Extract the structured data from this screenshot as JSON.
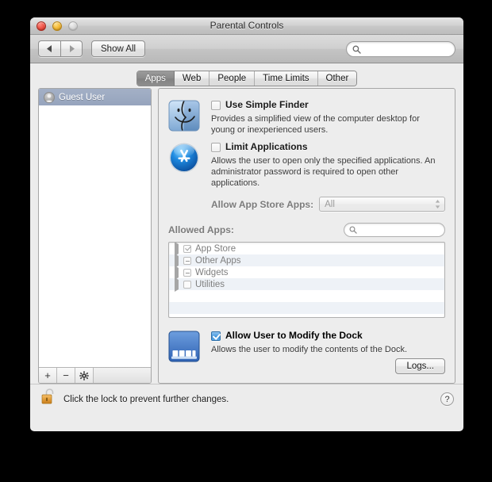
{
  "window": {
    "title": "Parental Controls",
    "traffic_lights": [
      "close",
      "minimize",
      "zoom-disabled"
    ]
  },
  "toolbar": {
    "back_icon": "triangle-left-icon",
    "forward_icon": "triangle-right-icon",
    "show_all_label": "Show All",
    "search": {
      "value": "",
      "placeholder": "",
      "icon": "search-icon"
    }
  },
  "tabs": [
    {
      "label": "Apps",
      "active": true
    },
    {
      "label": "Web",
      "active": false
    },
    {
      "label": "People",
      "active": false
    },
    {
      "label": "Time Limits",
      "active": false
    },
    {
      "label": "Other",
      "active": false
    }
  ],
  "sidebar": {
    "users": [
      {
        "name": "Guest User",
        "selected": true,
        "icon": "user-avatar-icon"
      }
    ],
    "footer": {
      "add_label": "+",
      "remove_label": "−",
      "gear_label": "⚙"
    }
  },
  "main": {
    "simple_finder": {
      "icon": "finder-icon",
      "checkbox_label": "Use Simple Finder",
      "checked": false,
      "description": "Provides a simplified view of the computer desktop for young or inexperienced users."
    },
    "limit_applications": {
      "icon": "app-store-icon",
      "checkbox_label": "Limit Applications",
      "checked": false,
      "description": "Allows the user to open only the specified applications. An administrator password is required to open other applications."
    },
    "allow_app_store": {
      "label": "Allow App Store Apps:",
      "value": "All",
      "disabled": true,
      "options": [
        "All"
      ]
    },
    "allowed_apps": {
      "label": "Allowed Apps:",
      "search": {
        "value": "",
        "placeholder": "",
        "icon": "search-icon"
      },
      "rows": [
        {
          "label": "App Store",
          "state": "checked",
          "expanded": false
        },
        {
          "label": "Other Apps",
          "state": "mixed",
          "expanded": false
        },
        {
          "label": "Widgets",
          "state": "mixed",
          "expanded": false
        },
        {
          "label": "Utilities",
          "state": "unchecked",
          "expanded": false
        }
      ]
    },
    "modify_dock": {
      "icon": "dock-icon",
      "checkbox_label": "Allow User to Modify the Dock",
      "checked": true,
      "description": "Allows the user to modify the contents of the Dock."
    },
    "logs_label": "Logs..."
  },
  "lockbar": {
    "icon": "unlocked-padlock-icon",
    "text": "Click the lock to prevent further changes.",
    "help_label": "?"
  }
}
